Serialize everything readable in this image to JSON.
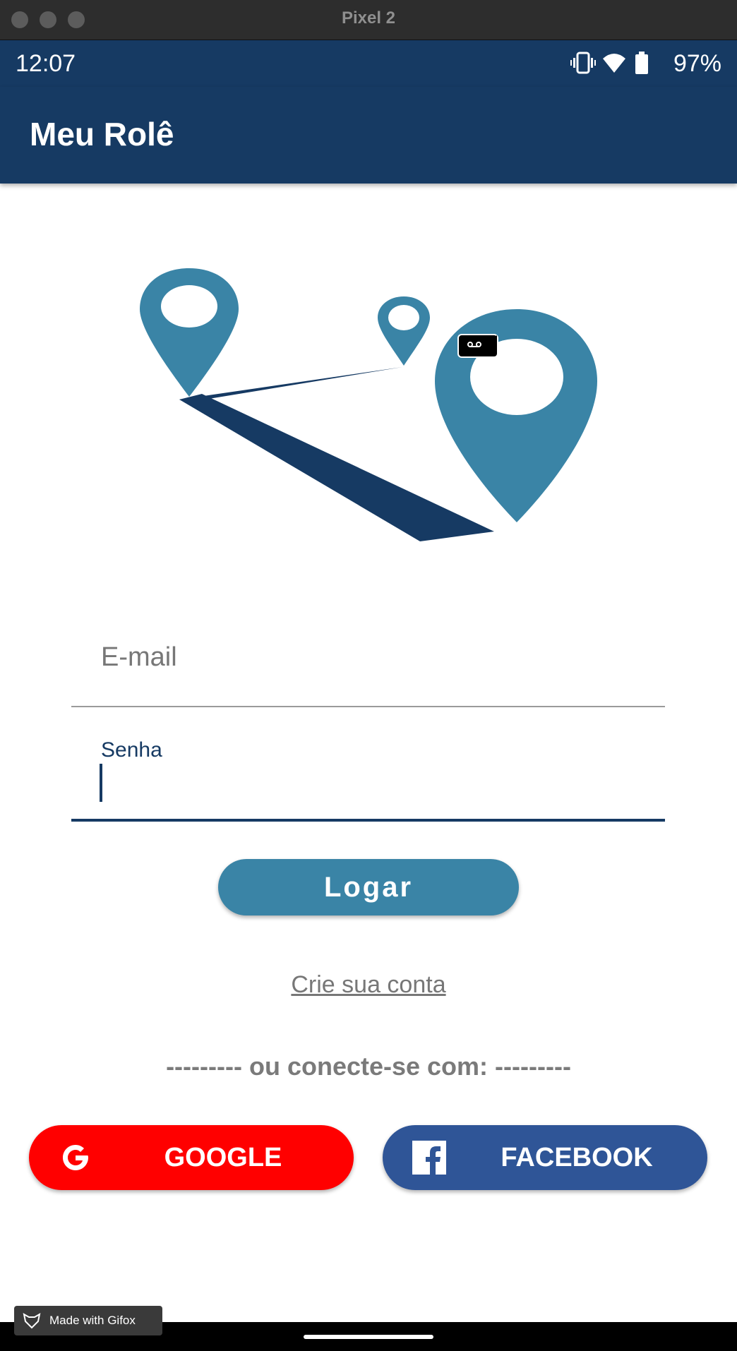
{
  "window": {
    "title": "Pixel 2"
  },
  "status_bar": {
    "time": "12:07",
    "battery": "97%"
  },
  "app_bar": {
    "title": "Meu Rolê"
  },
  "login_form": {
    "email_placeholder": "E-mail",
    "password_label": "Senha",
    "login_button": "Logar",
    "create_account_link": "Crie sua conta"
  },
  "social": {
    "divider": "--------- ou conecte-se com: ---------",
    "google_label": "GOOGLE",
    "facebook_label": "FACEBOOK"
  },
  "watermark": {
    "text": "Made with Gifox"
  },
  "colors": {
    "primary": "#163a63",
    "accent": "#3a84a6",
    "google": "#ff0000",
    "facebook": "#2f5597"
  }
}
